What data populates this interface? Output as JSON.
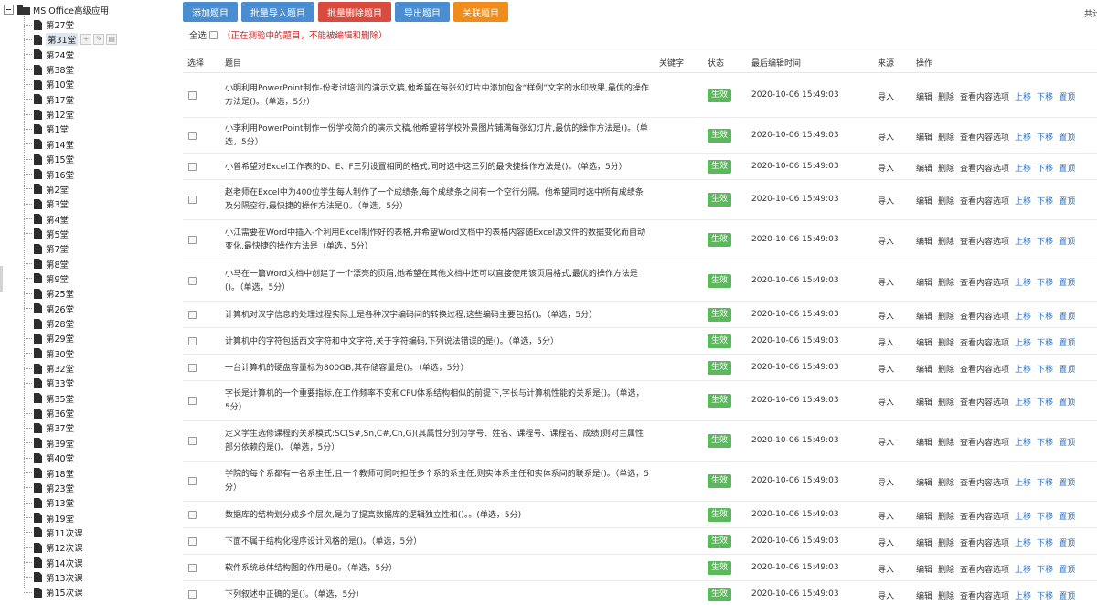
{
  "sidebar": {
    "root_label": "MS Office高级应用",
    "items": [
      {
        "label": "第27堂"
      },
      {
        "label": "第31堂",
        "selected": true
      },
      {
        "label": "第24堂"
      },
      {
        "label": "第38堂"
      },
      {
        "label": "第10堂"
      },
      {
        "label": "第17堂"
      },
      {
        "label": "第12堂"
      },
      {
        "label": "第1堂"
      },
      {
        "label": "第14堂"
      },
      {
        "label": "第15堂"
      },
      {
        "label": "第16堂"
      },
      {
        "label": "第2堂"
      },
      {
        "label": "第3堂"
      },
      {
        "label": "第4堂"
      },
      {
        "label": "第5堂"
      },
      {
        "label": "第7堂"
      },
      {
        "label": "第8堂"
      },
      {
        "label": "第9堂"
      },
      {
        "label": "第25堂"
      },
      {
        "label": "第26堂"
      },
      {
        "label": "第28堂"
      },
      {
        "label": "第29堂"
      },
      {
        "label": "第30堂"
      },
      {
        "label": "第32堂"
      },
      {
        "label": "第33堂"
      },
      {
        "label": "第35堂"
      },
      {
        "label": "第36堂"
      },
      {
        "label": "第37堂"
      },
      {
        "label": "第39堂"
      },
      {
        "label": "第40堂"
      },
      {
        "label": "第18堂"
      },
      {
        "label": "第23堂"
      },
      {
        "label": "第13堂"
      },
      {
        "label": "第19堂"
      },
      {
        "label": "第11次课"
      },
      {
        "label": "第12次课"
      },
      {
        "label": "第14次课"
      },
      {
        "label": "第13次课"
      },
      {
        "label": "第15次课"
      }
    ],
    "node_tools": [
      "+",
      "✎",
      "▤"
    ]
  },
  "toolbar": {
    "buttons": [
      {
        "label": "添加题目",
        "color": "#4a8ed1"
      },
      {
        "label": "批量导入题目",
        "color": "#4a8ed1"
      },
      {
        "label": "批量删除题目",
        "color": "#d94b3f"
      },
      {
        "label": "导出题目",
        "color": "#4a8ed1"
      },
      {
        "label": "关联题目",
        "color": "#f08c1b"
      }
    ],
    "total_label": "共计"
  },
  "select_all": {
    "label": "全选",
    "warning": "（正在测验中的题目，不能被编辑和删除）"
  },
  "table": {
    "headers": {
      "select": "选择",
      "title": "题目",
      "keyword": "关键字",
      "status": "状态",
      "time": "最后编辑时间",
      "source": "来源",
      "ops": "操作"
    },
    "ops": [
      "编辑",
      "删除",
      "查看内容选项",
      "上移",
      "下移",
      "置顶"
    ],
    "rows": [
      {
        "title": "小明利用PowerPoint制作-份考试培训的演示文稿,他希望在每张幻灯片中添加包含“样例”文字的水印效果,最优的操作方法是()。（单选，5分）",
        "status": "生效",
        "time": "2020-10-06 15:49:03",
        "source": "导入"
      },
      {
        "title": "小李利用PowerPoint制作一份学校简介的演示文稿,他希望将学校外景图片铺满每张幻灯片,最优的操作方法是()。（单选，5分）",
        "status": "生效",
        "time": "2020-10-06 15:49:03",
        "source": "导入"
      },
      {
        "title": "小曾希望对Excel工作表的D、E、F三列设置相同的格式,同时选中这三列的最快捷操作方法是()。（单选，5分）",
        "status": "生效",
        "time": "2020-10-06 15:49:03",
        "source": "导入"
      },
      {
        "title": "赵老师在Excel中为400位学生每人制作了一个成绩条,每个成绩条之间有一个空行分隔。他希望同时选中所有成绩条及分隔空行,最快捷的操作方法是()。（单选，5分）",
        "status": "生效",
        "time": "2020-10-06 15:49:03",
        "source": "导入"
      },
      {
        "title": "小江需要在Word中插入-个利用Excel制作好的表格,并希望Word文档中的表格内容随Excel源文件的数据变化而自动变化,最快捷的操作方法是（单选，5分）",
        "status": "生效",
        "time": "2020-10-06 15:49:03",
        "source": "导入"
      },
      {
        "title": "小马在一篇Word文档中创建了一个漂亮的页眉,她希望在其他文档中还可以直接使用该页眉格式,最优的操作方法是()。（单选，5分）",
        "status": "生效",
        "time": "2020-10-06 15:49:03",
        "source": "导入"
      },
      {
        "title": "计算机对汉字信息的处理过程实际上是各种汉字编码间的转换过程,这些编码主要包括()。（单选，5分）",
        "status": "生效",
        "time": "2020-10-06 15:49:03",
        "source": "导入"
      },
      {
        "title": "计算机中的字符包括西文字符和中文字符,关于字符编码,下列说法错误的是()。（单选，5分）",
        "status": "生效",
        "time": "2020-10-06 15:49:03",
        "source": "导入"
      },
      {
        "title": "一台计算机的硬盘容量标为800GB,其存储容量是()。（单选，5分）",
        "status": "生效",
        "time": "2020-10-06 15:49:03",
        "source": "导入"
      },
      {
        "title": "字长是计算机的一个重要指标,在工作频率不变和CPU体系结构相似的前提下,字长与计算机性能的关系是()。（单选，5分）",
        "status": "生效",
        "time": "2020-10-06 15:49:03",
        "source": "导入"
      },
      {
        "title": "定义学生选修课程的关系模式:SC(S#,Sn,C#,Cn,G)(其属性分别为学号、姓名、课程号、课程名、成绩)则对主属性部分依赖的是()。（单选，5分）",
        "status": "生效",
        "time": "2020-10-06 15:49:03",
        "source": "导入"
      },
      {
        "title": "学院的每个系都有一名系主任,且一个教师可同时担任多个系的系主任,则实体系主任和实体系间的联系是()。（单选，5分）",
        "status": "生效",
        "time": "2020-10-06 15:49:03",
        "source": "导入"
      },
      {
        "title": "数据库的结构划分成多个层次,是为了提高数据库的逻辑独立性和()。。(单选，5分)",
        "status": "生效",
        "time": "2020-10-06 15:49:03",
        "source": "导入"
      },
      {
        "title": "下面不属于结构化程序设计风格的是()。（单选，5分）",
        "status": "生效",
        "time": "2020-10-06 15:49:03",
        "source": "导入"
      },
      {
        "title": "软件系统总体结构图的作用是()。（单选，5分）",
        "status": "生效",
        "time": "2020-10-06 15:49:03",
        "source": "导入"
      },
      {
        "title": "下列叙述中正确的是()。（单选，5分）",
        "status": "生效",
        "time": "2020-10-06 15:49:03",
        "source": "导入"
      }
    ]
  }
}
